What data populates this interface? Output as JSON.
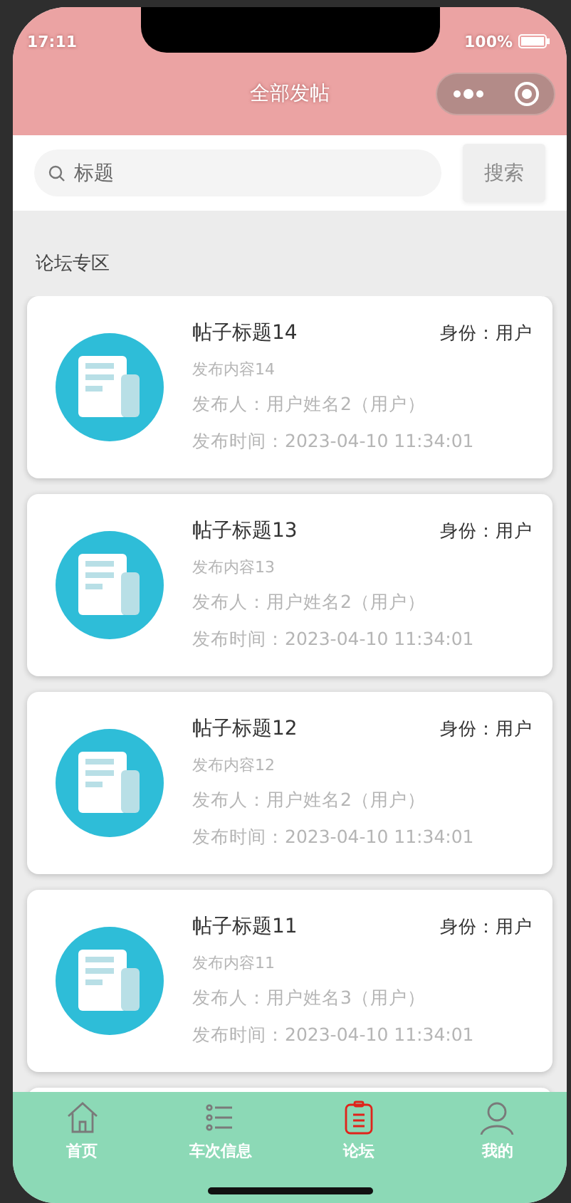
{
  "status_bar": {
    "time": "17:11",
    "battery": "100%"
  },
  "nav": {
    "title": "全部发帖"
  },
  "search": {
    "placeholder": "标题",
    "button": "搜索"
  },
  "section_title": "论坛专区",
  "posts": [
    {
      "title": "帖子标题14",
      "role": "身份：用户",
      "content": "发布内容14",
      "author": "发布人：用户姓名2（用户）",
      "time": "发布时间：2023-04-10 11:34:01"
    },
    {
      "title": "帖子标题13",
      "role": "身份：用户",
      "content": "发布内容13",
      "author": "发布人：用户姓名2（用户）",
      "time": "发布时间：2023-04-10 11:34:01"
    },
    {
      "title": "帖子标题12",
      "role": "身份：用户",
      "content": "发布内容12",
      "author": "发布人：用户姓名2（用户）",
      "time": "发布时间：2023-04-10 11:34:01"
    },
    {
      "title": "帖子标题11",
      "role": "身份：用户",
      "content": "发布内容11",
      "author": "发布人：用户姓名3（用户）",
      "time": "发布时间：2023-04-10 11:34:01"
    }
  ],
  "tabs": [
    {
      "label": "首页",
      "kind": "home",
      "selected": false
    },
    {
      "label": "车次信息",
      "kind": "list",
      "selected": false
    },
    {
      "label": "论坛",
      "kind": "clipboard",
      "selected": true
    },
    {
      "label": "我的",
      "kind": "user",
      "selected": false
    }
  ]
}
